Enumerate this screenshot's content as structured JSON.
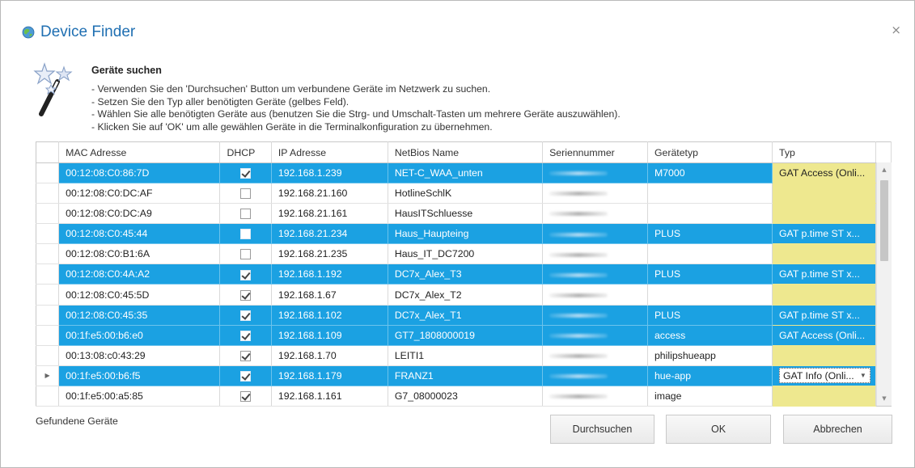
{
  "dialog": {
    "title": "Device Finder",
    "close_glyph": "×"
  },
  "info": {
    "heading": "Geräte suchen",
    "lines": [
      "- Verwenden Sie den 'Durchsuchen' Button um verbundene Geräte im Netzwerk zu suchen.",
      "- Setzen Sie den Typ aller benötigten Geräte (gelbes Feld).",
      "- Wählen Sie alle benötigten Geräte aus (benutzen Sie die Strg- und Umschalt-Tasten um mehrere Geräte auszuwählen).",
      "- Klicken Sie auf 'OK' um alle gewählen Geräte in die Terminalkonfiguration zu übernehmen."
    ]
  },
  "table": {
    "columns": [
      "MAC Adresse",
      "DHCP",
      "IP Adresse",
      "NetBios Name",
      "Seriennummer",
      "Gerätetyp",
      "Typ"
    ],
    "rows": [
      {
        "mac": "00:12:08:C0:86:7D",
        "dhcp": true,
        "ip": "192.168.1.239",
        "netbios": "NET-C_WAA_unten",
        "devtype": "M7000",
        "typ": "GAT Access (Onli...",
        "selected": true,
        "current": false,
        "typ_yellow_when_selected": true
      },
      {
        "mac": "00:12:08:C0:DC:AF",
        "dhcp": false,
        "ip": "192.168.21.160",
        "netbios": "HotlineSchlK",
        "devtype": "",
        "typ": "",
        "selected": false,
        "current": false,
        "typ_yellow_when_selected": false
      },
      {
        "mac": "00:12:08:C0:DC:A9",
        "dhcp": false,
        "ip": "192.168.21.161",
        "netbios": "HausITSchluesse",
        "devtype": "",
        "typ": "",
        "selected": false,
        "current": false,
        "typ_yellow_when_selected": false
      },
      {
        "mac": "00:12:08:C0:45:44",
        "dhcp": false,
        "ip": "192.168.21.234",
        "netbios": "Haus_Haupteing",
        "devtype": "PLUS",
        "typ": "GAT p.time ST x...",
        "selected": true,
        "current": false,
        "typ_yellow_when_selected": false
      },
      {
        "mac": "00:12:08:C0:B1:6A",
        "dhcp": false,
        "ip": "192.168.21.235",
        "netbios": "Haus_IT_DC7200",
        "devtype": "",
        "typ": "",
        "selected": false,
        "current": false,
        "typ_yellow_when_selected": false
      },
      {
        "mac": "00:12:08:C0:4A:A2",
        "dhcp": true,
        "ip": "192.168.1.192",
        "netbios": "DC7x_Alex_T3",
        "devtype": "PLUS",
        "typ": "GAT p.time ST x...",
        "selected": true,
        "current": false,
        "typ_yellow_when_selected": false
      },
      {
        "mac": "00:12:08:C0:45:5D",
        "dhcp": true,
        "ip": "192.168.1.67",
        "netbios": "DC7x_Alex_T2",
        "devtype": "",
        "typ": "",
        "selected": false,
        "current": false,
        "typ_yellow_when_selected": false
      },
      {
        "mac": "00:12:08:C0:45:35",
        "dhcp": true,
        "ip": "192.168.1.102",
        "netbios": "DC7x_Alex_T1",
        "devtype": "PLUS",
        "typ": "GAT p.time ST x...",
        "selected": true,
        "current": false,
        "typ_yellow_when_selected": false
      },
      {
        "mac": "00:1f:e5:00:b6:e0",
        "dhcp": true,
        "ip": "192.168.1.109",
        "netbios": "GT7_1808000019",
        "devtype": "access",
        "typ": "GAT Access (Onli...",
        "selected": true,
        "current": false,
        "typ_yellow_when_selected": false
      },
      {
        "mac": "00:13:08:c0:43:29",
        "dhcp": true,
        "ip": "192.168.1.70",
        "netbios": "LEITI1",
        "devtype": "philipshueapp",
        "typ": "",
        "selected": false,
        "current": false,
        "typ_yellow_when_selected": false
      },
      {
        "mac": "00:1f:e5:00:b6:f5",
        "dhcp": true,
        "ip": "192.168.1.179",
        "netbios": "FRANZ1",
        "devtype": "hue-app",
        "typ": "GAT Info (Onli...",
        "selected": true,
        "current": true,
        "typ_yellow_when_selected": false
      },
      {
        "mac": "00:1f:e5:00:a5:85",
        "dhcp": true,
        "ip": "192.168.1.161",
        "netbios": "G7_08000023",
        "devtype": "image",
        "typ": "",
        "selected": false,
        "current": false,
        "typ_yellow_when_selected": false
      }
    ]
  },
  "footer": {
    "found_label": "Gefundene Geräte",
    "search_button": "Durchsuchen",
    "ok_button": "OK",
    "cancel_button": "Abbrechen"
  },
  "colors": {
    "title": "#1f6fb2",
    "selection": "#1ba1e2",
    "type_column": "#eee88f"
  },
  "icons": {
    "title": "globe-icon",
    "header": "magic-wand-stars-icon",
    "row_indicator": "current-row-arrow-icon",
    "close": "close-icon"
  }
}
